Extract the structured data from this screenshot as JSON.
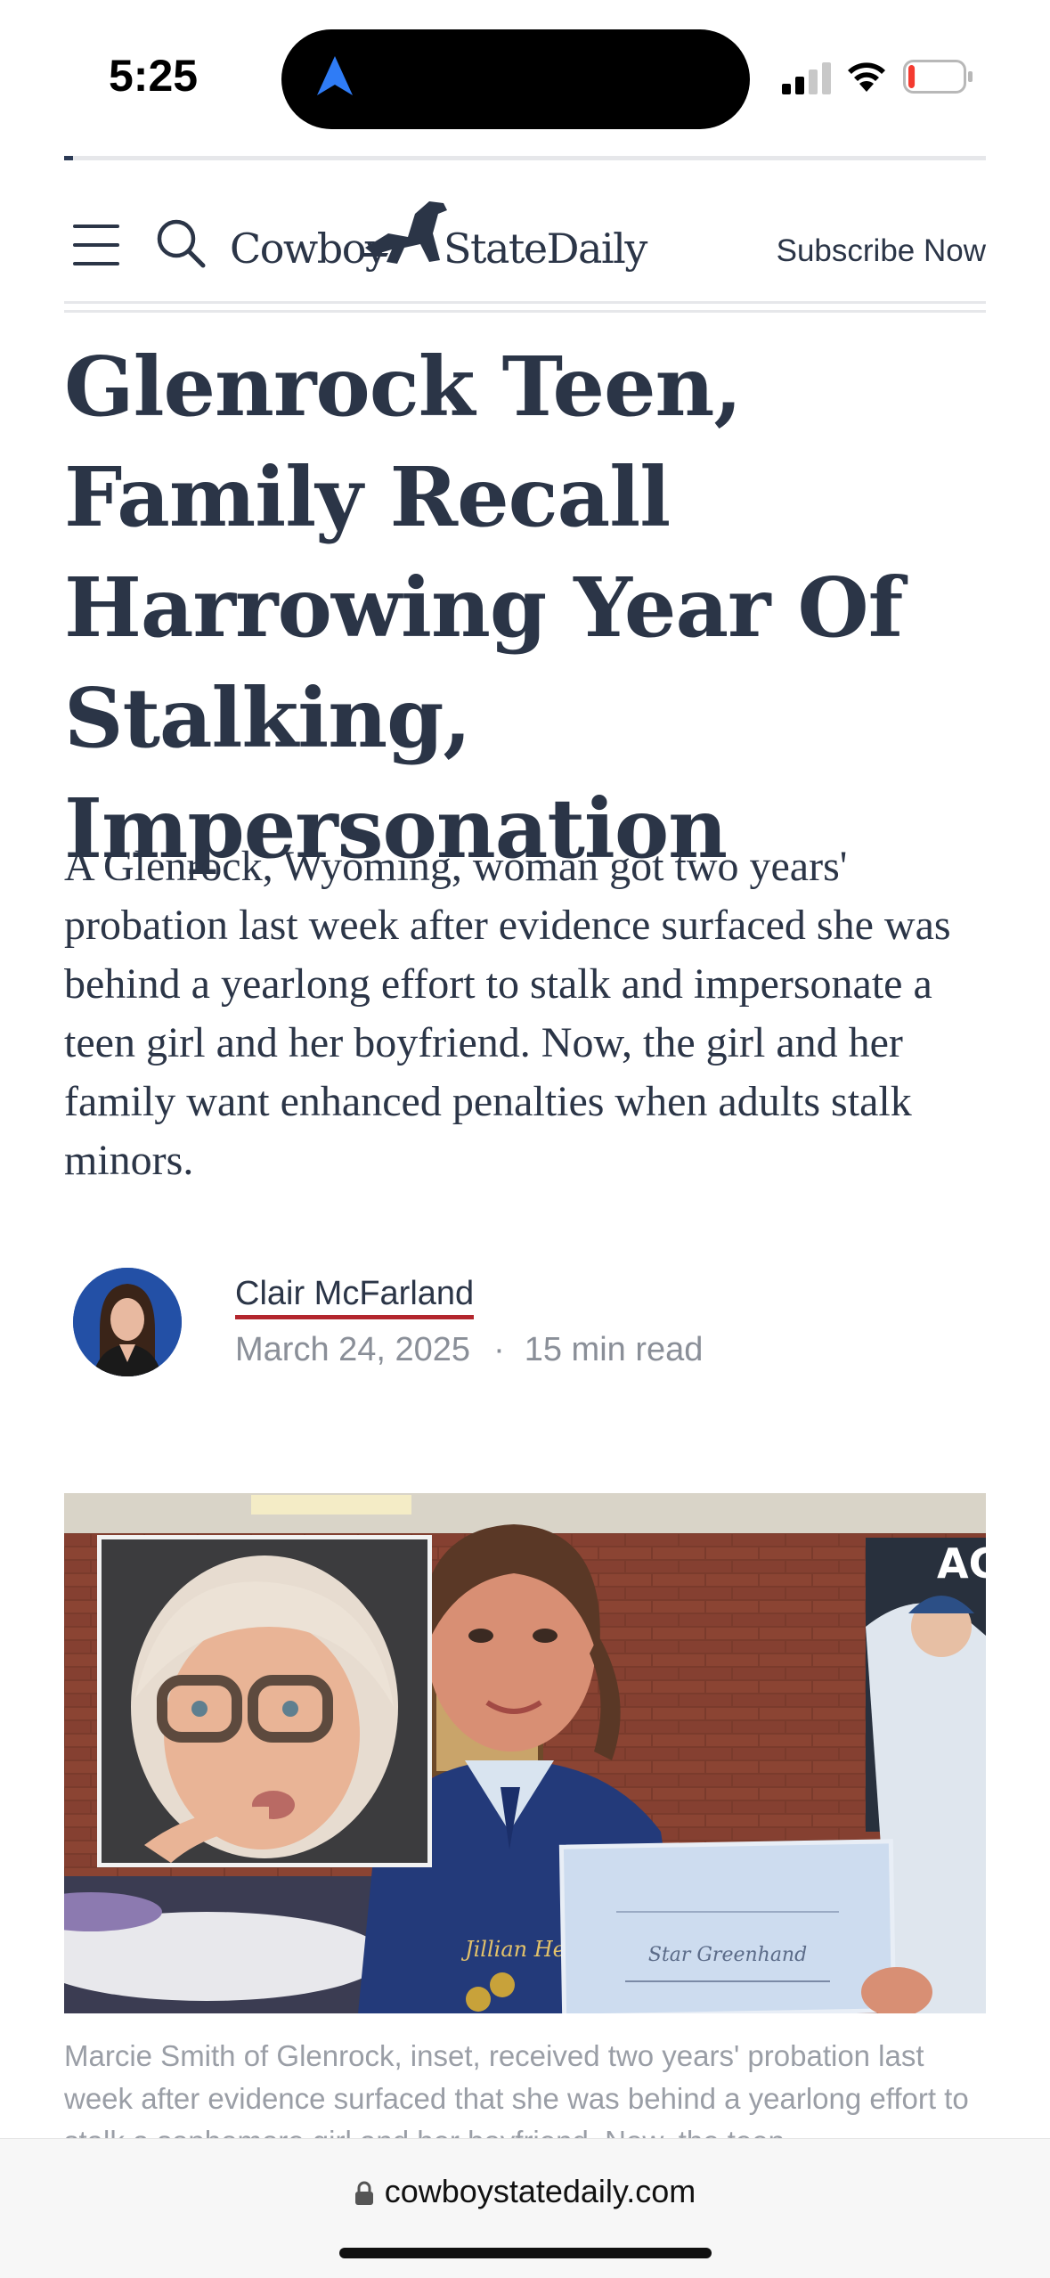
{
  "status_bar": {
    "time": "5:25",
    "battery_level": 0.12,
    "signal_bars": 2
  },
  "header": {
    "logo_left": "Cowboy",
    "logo_right": "StateDaily",
    "subscribe_label": "Subscribe Now",
    "reading_progress": 0.01
  },
  "article": {
    "headline": "Glenrock Teen, Family Recall Harrowing Year Of Stalking, Impersonation",
    "dek": "A Glenrock, Wyoming, woman got two years' probation last week after evidence surfaced she was behind a yearlong effort to stalk and impersonate a teen girl and her boyfriend. Now, the girl and her family want enhanced penalties when adults stalk minors.",
    "author": "Clair McFarland",
    "date": "March 24, 2025",
    "separator": "·",
    "read_time": "15 min read",
    "caption": "Marcie Smith of Glenrock, inset, received two years' probation last week after evidence surfaced that she was behind a yearlong effort to stalk a sophomore girl and her boyfriend. Now, the teen"
  },
  "photo": {
    "jacket_name": "Jillian Heiman",
    "certificate_title": "Star Greenhand",
    "banner_text": "AG"
  },
  "browser": {
    "url": "cowboystatedaily.com"
  },
  "colors": {
    "text": "#2b3547",
    "author_underline": "#b3262d",
    "muted": "#8a8f98"
  }
}
